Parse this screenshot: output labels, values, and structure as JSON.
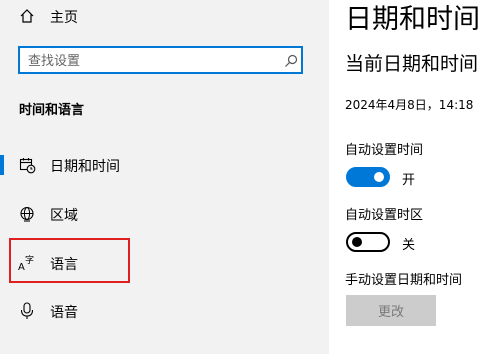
{
  "sidebar": {
    "home_label": "主页",
    "search_placeholder": "查找设置",
    "section_title": "时间和语言",
    "items": [
      {
        "label": "日期和时间",
        "icon": "calendar-clock-icon",
        "selected": true
      },
      {
        "label": "区域",
        "icon": "globe-icon",
        "selected": false
      },
      {
        "label": "语言",
        "icon": "language-icon",
        "selected": false
      },
      {
        "label": "语音",
        "icon": "microphone-icon",
        "selected": false
      }
    ]
  },
  "main": {
    "page_title": "日期和时间",
    "current_heading": "当前日期和时间",
    "current_datetime": "2024年4月8日，14:18",
    "auto_time": {
      "label": "自动设置时间",
      "state_label": "开",
      "on": true
    },
    "auto_timezone": {
      "label": "自动设置时区",
      "state_label": "关",
      "on": false
    },
    "manual": {
      "label": "手动设置日期和时间",
      "button_label": "更改"
    }
  },
  "colors": {
    "accent": "#0078d7",
    "sidebar_bg": "#f2f2f2",
    "highlight_box": "#e02020",
    "disabled_button": "#cccccc"
  }
}
